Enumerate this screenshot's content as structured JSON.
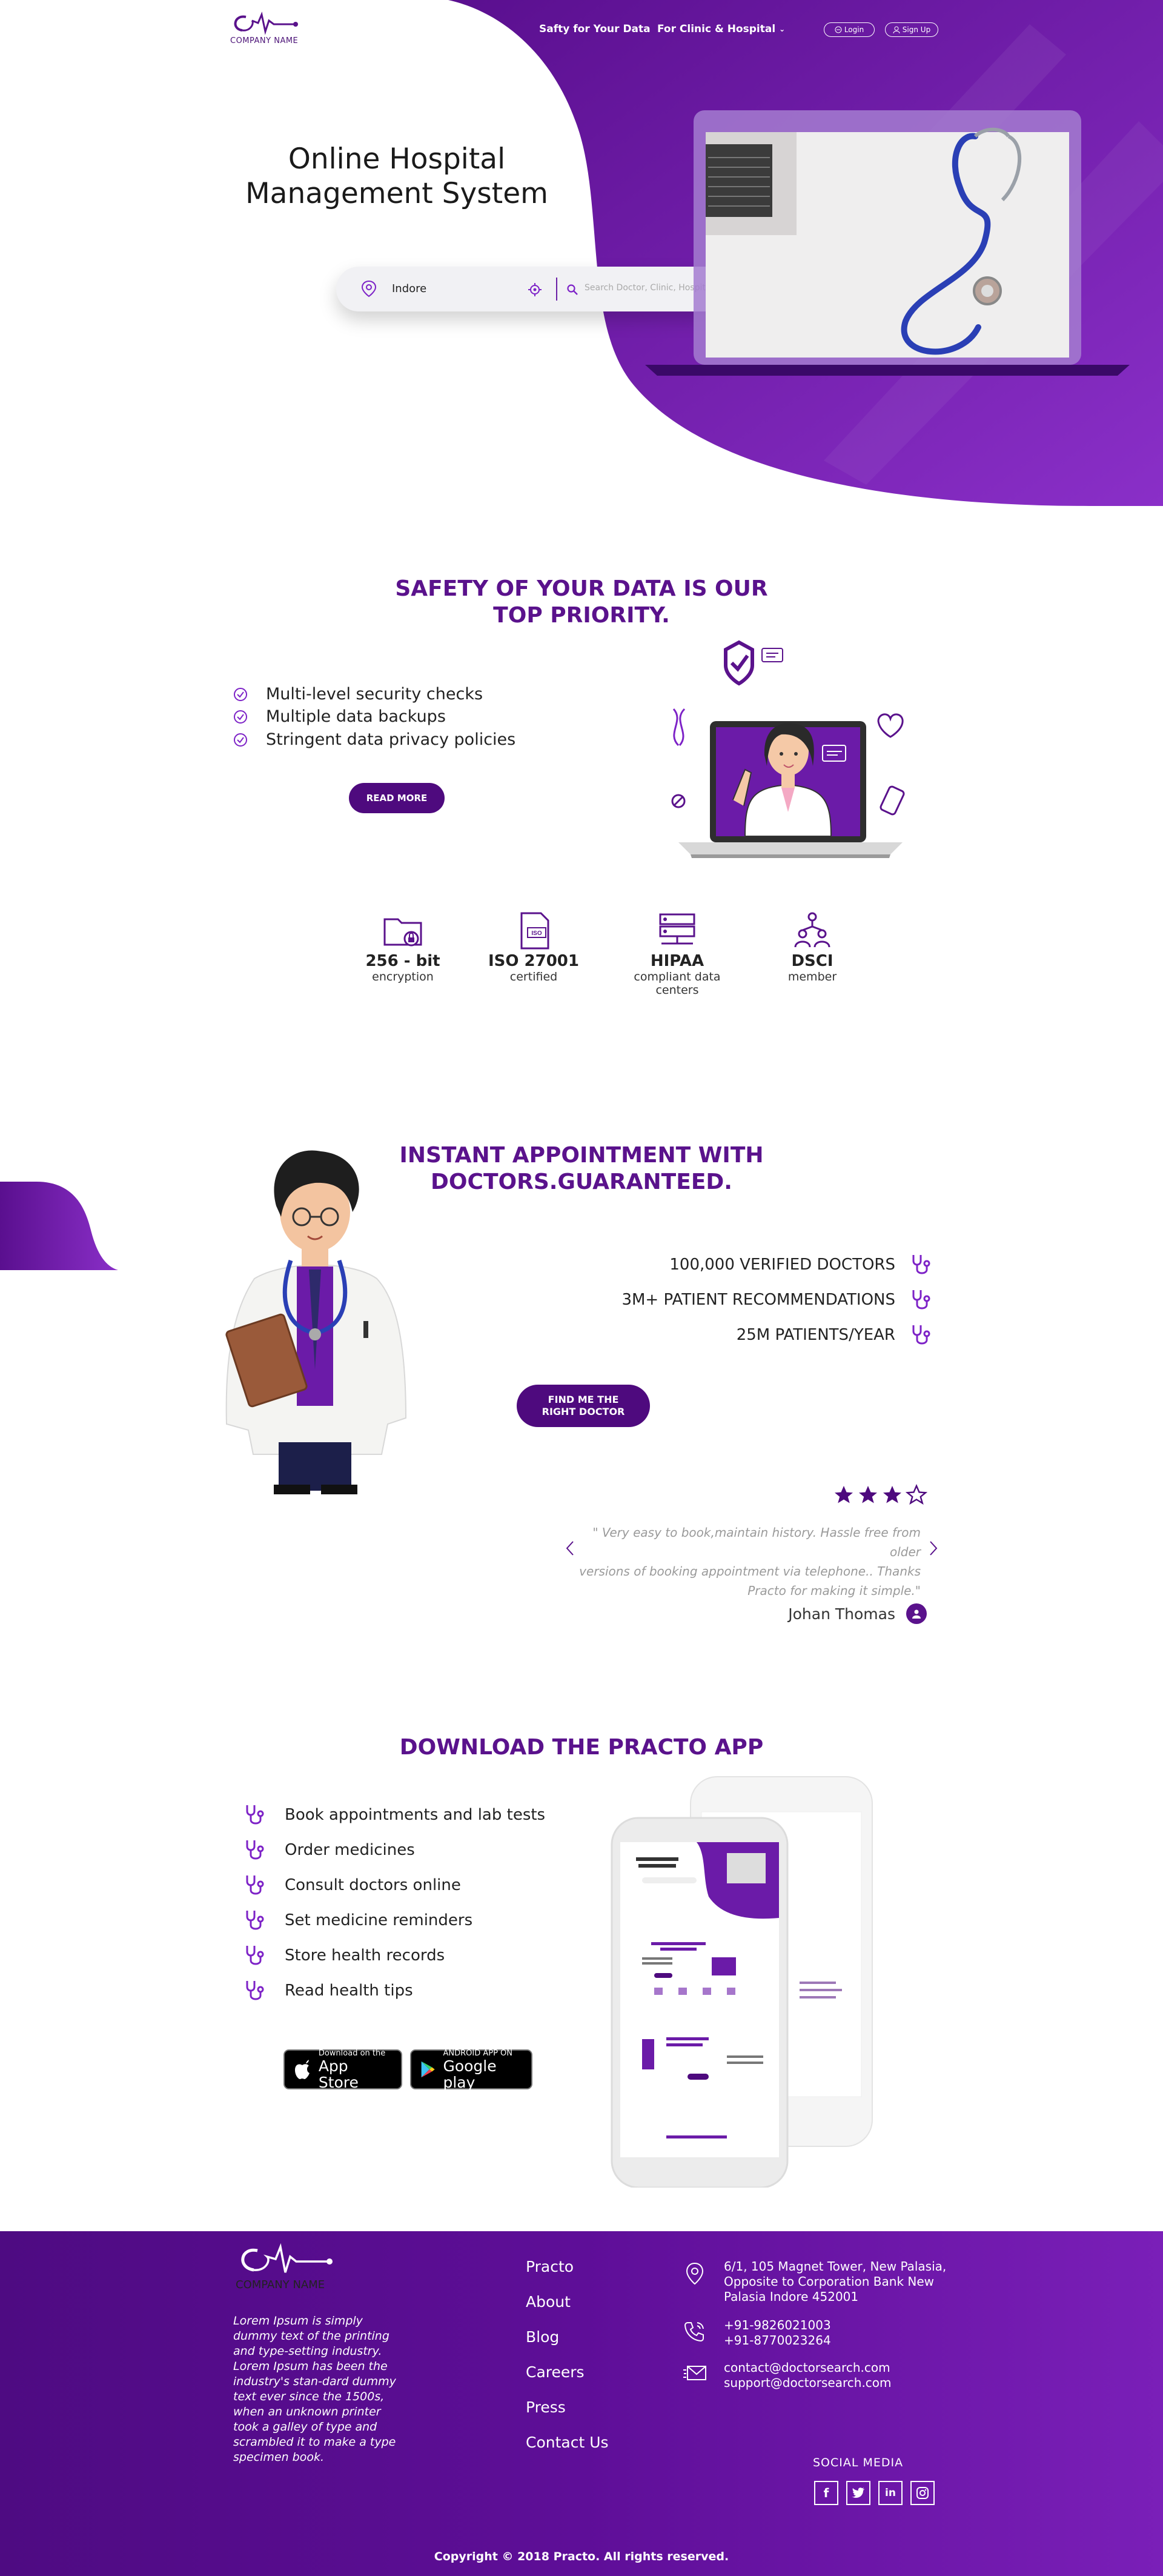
{
  "brand": {
    "logo_text": "COMPANY NAME",
    "primary_color": "#5a128c",
    "accent_color": "#7d22c7"
  },
  "nav": {
    "link_1": "Safty for Your Data",
    "link_2": "For Clinic & Hospital",
    "login": "Login",
    "signup": "Sign Up"
  },
  "hero": {
    "title_line_1": "Online Hospital",
    "title_line_2": "Management System",
    "city_value": "Indore",
    "search_placeholder": "Search Doctor, Clinic, Hospital ect"
  },
  "safety": {
    "title_line_1": "SAFETY OF YOUR DATA IS OUR",
    "title_line_2": "TOP PRIORITY.",
    "checks": [
      "Multi-level security checks",
      "Multiple data backups",
      "Stringent data privacy policies"
    ],
    "read_more": "READ MORE",
    "certs": [
      {
        "big": "256 - bit",
        "small": "encryption",
        "icon": "folder-lock-icon"
      },
      {
        "big": "ISO 27001",
        "small": "certified",
        "icon": "iso-document-icon"
      },
      {
        "big": "HIPAA",
        "small": "compliant data centers",
        "icon": "server-icon"
      },
      {
        "big": "DSCI",
        "small": "member",
        "icon": "people-network-icon"
      }
    ]
  },
  "appointment": {
    "title_line_1": "INSTANT APPOINTMENT WITH",
    "title_line_2": "DOCTORS.GUARANTEED.",
    "stats": [
      "100,000 VERIFIED DOCTORS",
      "3M+ PATIENT RECOMMENDATIONS",
      "25M PATIENTS/YEAR"
    ],
    "cta_line_1": "FIND ME THE",
    "cta_line_2": "RIGHT DOCTOR",
    "rating_filled": 3,
    "rating_max": 4,
    "review_line_1": "\" Very easy to book,maintain history. Hassle free from older",
    "review_line_2": "versions of booking appointment via telephone.. Thanks",
    "review_line_3": "Practo for making it simple.\"",
    "reviewer": "Johan Thomas"
  },
  "download": {
    "title": "DOWNLOAD THE PRACTO APP",
    "features": [
      "Book appointments and lab tests",
      "Order medicines",
      "Consult doctors online",
      "Set medicine reminders",
      "Store health records",
      "Read health tips"
    ],
    "appstore_small": "Download on the",
    "appstore_big": "App Store",
    "play_small": "ANDROID APP ON",
    "play_big": "Google play"
  },
  "footer": {
    "logo_text": "COMPANY NAME",
    "about": "Lorem Ipsum is simply dummy text of the printing and type-setting industry. Lorem Ipsum has been the industry's stan-dard dummy text ever since the 1500s, when an unknown printer took a galley of type and scrambled it to make a type specimen book.",
    "links": [
      "Practo",
      "About",
      "Blog",
      "Careers",
      "Press",
      "Contact Us"
    ],
    "address_1": "6/1, 105 Magnet Tower, New Palasia,",
    "address_2": "Opposite to Corporation Bank New",
    "address_3": "Palasia Indore 452001",
    "phone_1": "+91-9826021003",
    "phone_2": "+91-8770023264",
    "email_1": "contact@doctorsearch.com",
    "email_2": "support@doctorsearch.com",
    "social_label": "SOCIAL MEDIA",
    "social": [
      "f",
      "t",
      "in",
      "ig"
    ],
    "copyright": "Copyright © 2018 Practo. All rights reserved."
  }
}
